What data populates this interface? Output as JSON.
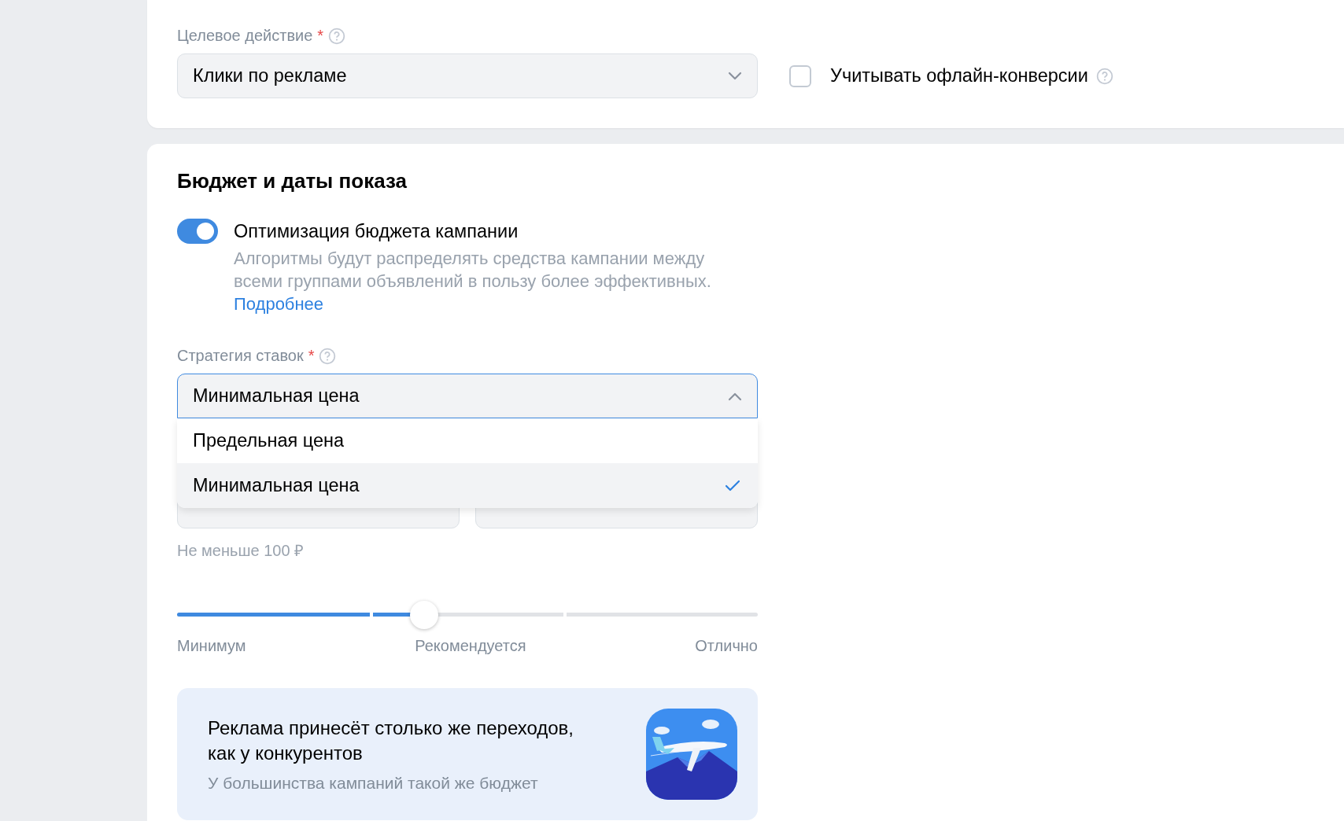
{
  "target_action": {
    "label": "Целевое действие",
    "required_mark": "*",
    "value": "Клики по рекламе"
  },
  "offline_conversions": {
    "label": "Учитывать офлайн-конверсии",
    "checked": false
  },
  "budget_section": {
    "title": "Бюджет и даты показа",
    "optimization": {
      "label": "Оптимизация бюджета кампании",
      "on": true,
      "description": "Алгоритмы будут распределять средства кампании между всеми группами объявлений в пользу более эффективных.",
      "link": "Подробнее"
    },
    "strategy": {
      "label": "Стратегия ставок",
      "required_mark": "*",
      "value": "Минимальная цена",
      "expanded": true,
      "options": [
        {
          "label": "Предельная цена",
          "selected": false
        },
        {
          "label": "Минимальная цена",
          "selected": true
        }
      ]
    },
    "budget_hint": "Не меньше 100 ₽",
    "slider": {
      "level": 0.425,
      "labels": [
        "Минимум",
        "Рекомендуется",
        "Отлично"
      ]
    },
    "banner": {
      "title": "Реклама принесёт столько же переходов, как у конкурентов",
      "subtitle": "У большинства кампаний такой же бюджет"
    }
  }
}
